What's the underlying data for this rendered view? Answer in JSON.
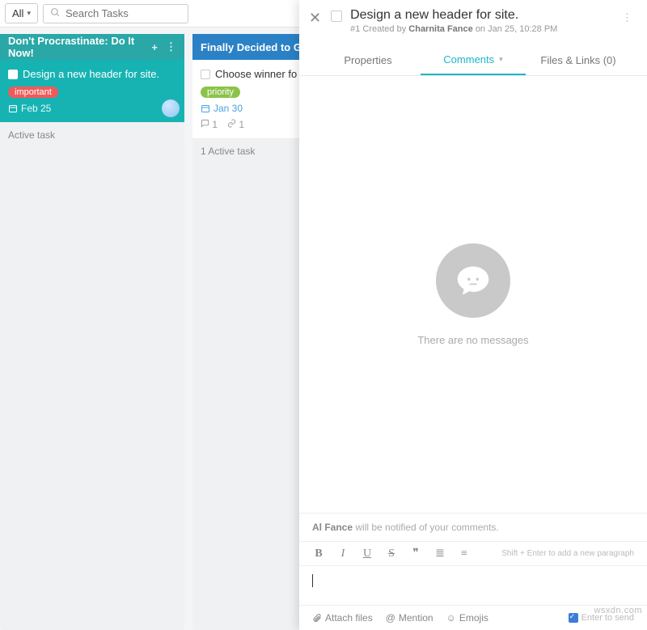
{
  "topbar": {
    "filter_label": "All",
    "search_placeholder": "Search Tasks"
  },
  "columns": [
    {
      "title": "Don't Procrastinate: Do It Now!",
      "accent": "teal",
      "cards": [
        {
          "title": "Design a new header for site.",
          "tag": "important",
          "tag_color": "red",
          "date": "Feb 25",
          "selected": true
        }
      ],
      "footer": "Active task"
    },
    {
      "title": "Finally Decided to G",
      "accent": "blue",
      "cards": [
        {
          "title": "Choose winner fo",
          "tag": "priority",
          "tag_color": "green",
          "date": "Jan 30",
          "comments": "1",
          "links": "1"
        }
      ],
      "footer": "1 Active task"
    }
  ],
  "panel": {
    "title": "Design a new header for site.",
    "id": "#1",
    "created_label": "Created by",
    "author": "Charnita Fance",
    "on_label": "on",
    "timestamp": "Jan 25, 10:28 PM",
    "tabs": {
      "properties": "Properties",
      "comments": "Comments",
      "files": "Files & Links (0)"
    },
    "empty_text": "There are no messages",
    "notify_name": "Al Fance",
    "notify_text": "will be notified of your comments.",
    "toolbar_hint": "Shift + Enter to add a new paragraph",
    "attach": {
      "files": "Attach files",
      "mention": "Mention",
      "emojis": "Emojis",
      "enter_send": "Enter to send"
    }
  },
  "watermark": "wsxdn.com"
}
